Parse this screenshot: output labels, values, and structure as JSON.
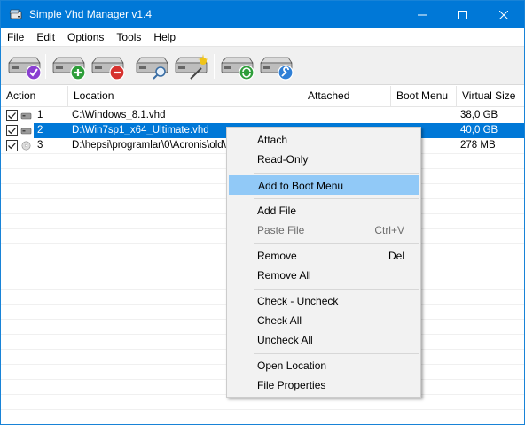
{
  "window": {
    "title": "Simple Vhd Manager v1.4"
  },
  "menubar": {
    "items": [
      "File",
      "Edit",
      "Options",
      "Tools",
      "Help"
    ]
  },
  "toolbar": {
    "buttons": [
      "attach-disk",
      "add-disk",
      "remove-disk",
      "disk-properties",
      "disk-settings",
      "refresh-disk",
      "configure-disk"
    ]
  },
  "table": {
    "columns": [
      "Action",
      "Location",
      "Attached",
      "Boot Menu",
      "Virtual Size"
    ],
    "rows": [
      {
        "checked": true,
        "index": "1",
        "location": "C:\\Windows_8.1.vhd",
        "attached": "",
        "boot_menu": "",
        "size": "38,0 GB",
        "icon": "drive-icon"
      },
      {
        "checked": true,
        "index": "2",
        "location": "D:\\Win7sp1_x64_Ultimate.vhd",
        "attached": "",
        "boot_menu": "",
        "size": "40,0 GB",
        "icon": "drive-icon"
      },
      {
        "checked": true,
        "index": "3",
        "location": "D:\\hepsi\\programlar\\0\\Acronis\\old\\A",
        "attached": "",
        "boot_menu": "",
        "size": "278 MB",
        "icon": "disc-icon"
      }
    ]
  },
  "context_menu": {
    "attach": "Attach",
    "read_only": "Read-Only",
    "add_to_boot": "Add to Boot Menu",
    "add_file": "Add File",
    "paste_file": "Paste File",
    "paste_shortcut": "Ctrl+V",
    "remove": "Remove",
    "remove_shortcut": "Del",
    "remove_all": "Remove All",
    "check_uncheck": "Check - Uncheck",
    "check_all": "Check All",
    "uncheck_all": "Uncheck All",
    "open_location": "Open Location",
    "file_properties": "File Properties"
  },
  "colors": {
    "titlebar": "#0078d7",
    "selection": "#0078d7",
    "menu_hover": "#91c9f7"
  }
}
